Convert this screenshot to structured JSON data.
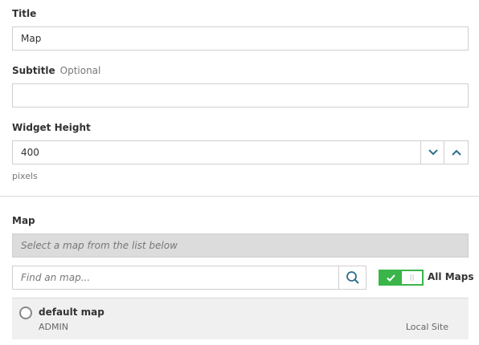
{
  "title_field": {
    "label": "Title",
    "value": "Map"
  },
  "subtitle_field": {
    "label": "Subtitle",
    "optional_tag": "Optional",
    "value": ""
  },
  "height_field": {
    "label": "Widget Height",
    "value": "400",
    "unit_hint": "pixels"
  },
  "map_section": {
    "label": "Map",
    "banner": "Select a map from the list below",
    "search_placeholder": "Find an map...",
    "toggle": {
      "state": "on",
      "label": "All Maps"
    },
    "maps": [
      {
        "name": "default map",
        "owner": "ADMIN",
        "site": "Local Site",
        "selected": false
      }
    ]
  },
  "colors": {
    "accent_blue": "#2c6e8f",
    "toggle_green": "#3ab54a"
  }
}
